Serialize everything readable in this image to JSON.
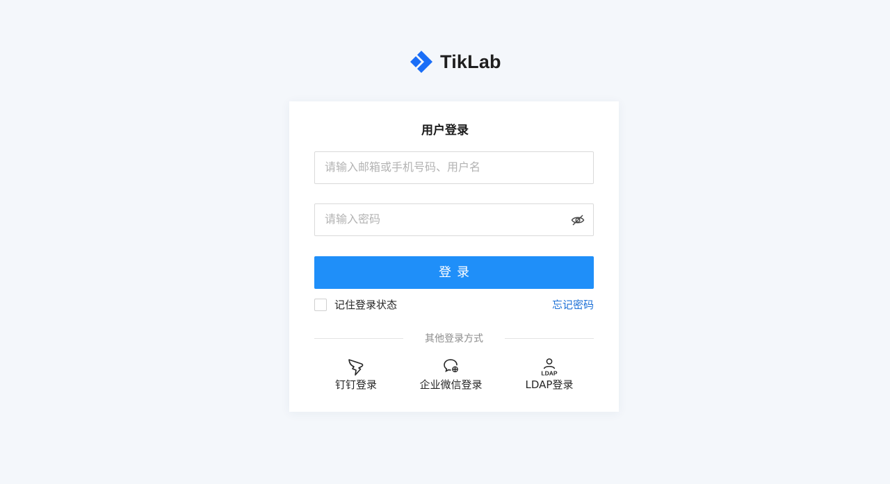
{
  "brand": {
    "name": "TikLab",
    "logo_icon": "tiklab-diamond-logo-icon",
    "accent": "#1a6ef7"
  },
  "login": {
    "title": "用户登录",
    "username_placeholder": "请输入邮箱或手机号码、用户名",
    "username_value": "",
    "password_placeholder": "请输入密码",
    "password_value": "",
    "password_toggle_icon": "eye-off-icon",
    "submit_label": "登录",
    "submit_color": "#1f8ff9",
    "remember_label": "记住登录状态",
    "remember_checked": false,
    "forgot_label": "忘记密码",
    "link_color": "#1b6fd6"
  },
  "other_login": {
    "divider_label": "其他登录方式",
    "options": [
      {
        "label": "钉钉登录",
        "icon": "dingtalk-icon"
      },
      {
        "label": "企业微信登录",
        "icon": "wecom-icon"
      },
      {
        "label": "LDAP登录",
        "icon": "ldap-user-icon",
        "icon_text": "LDAP"
      }
    ]
  }
}
